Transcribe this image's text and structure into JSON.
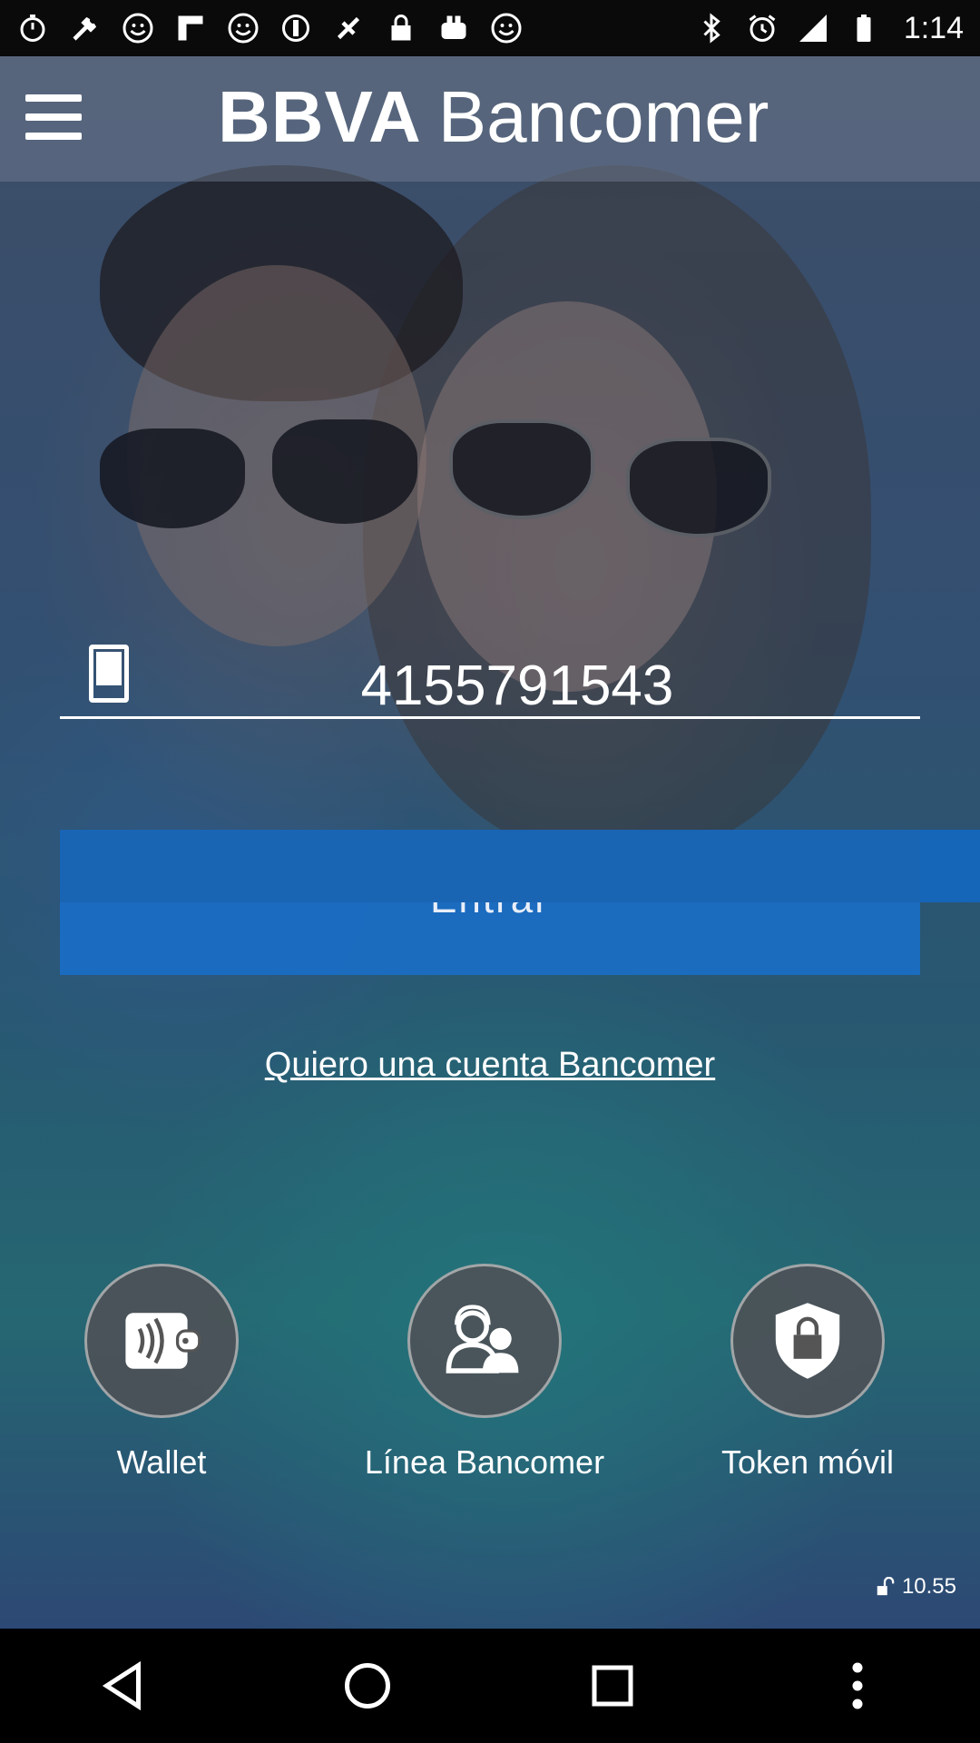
{
  "status_bar": {
    "time": "1:14",
    "icons": [
      "stopwatch-icon",
      "wrench-icon",
      "smiley-icon",
      "flipboard-icon",
      "smiley-icon",
      "coin-icon",
      "fake-gps-icon",
      "lock-icon",
      "toaster-icon",
      "smiley-icon",
      "bluetooth-icon",
      "alarm-icon",
      "signal-icon",
      "battery-icon"
    ]
  },
  "header": {
    "logo_bold": "BBVA",
    "logo_light": "Bancomer"
  },
  "login": {
    "phone_value": "4155791543",
    "enter_label": "Entrar",
    "account_link": "Quiero una cuenta Bancomer"
  },
  "shortcuts": {
    "wallet": "Wallet",
    "linea": "Línea Bancomer",
    "token": "Token móvil"
  },
  "version": "10.55",
  "colors": {
    "primary_blue": "#1a64b4",
    "text": "#ffffff"
  }
}
